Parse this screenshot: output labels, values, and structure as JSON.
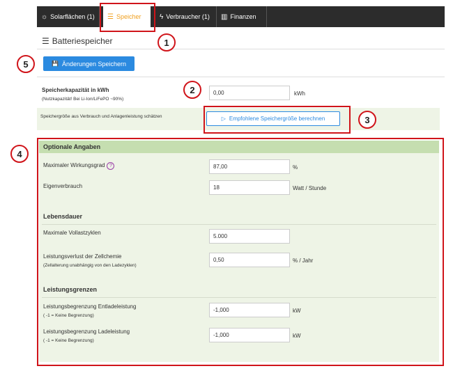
{
  "tabs": [
    {
      "label": "Solarflächen (1)",
      "icon": "sun-icon",
      "glyph": "☼"
    },
    {
      "label": "Speicher",
      "icon": "battery-list-icon",
      "glyph": "☰"
    },
    {
      "label": "Verbraucher (1)",
      "icon": "bolt-icon",
      "glyph": "ϟ"
    },
    {
      "label": "Finanzen",
      "icon": "chart-icon",
      "glyph": "▥"
    }
  ],
  "section": {
    "title": "Batteriespeicher",
    "icon_glyph": "☰"
  },
  "toolbar": {
    "save_label": "Änderungen Speichern",
    "save_icon": "💾"
  },
  "capacity": {
    "label": "Speicherkapazität in kWh",
    "sublabel": "(Nutzkapazität! Bei Li-Ion/LiFePO ~90%)",
    "value": "0,00",
    "unit": "kWh"
  },
  "estimate": {
    "label": "Speichergröße aus Verbrauch und Anlagenleistung schätzen",
    "button_label": "Empfohlene Speichergröße berechnen",
    "button_icon": "▷"
  },
  "optional": {
    "title": "Optionale Angaben",
    "efficiency": {
      "label": "Maximaler Wirkungsgrad",
      "help": "?",
      "value": "87,00",
      "unit": "%"
    },
    "self_consumption": {
      "label": "Eigenverbrauch",
      "value": "18",
      "unit": "Watt / Stunde"
    },
    "lifetime_title": "Lebensdauer",
    "cycles": {
      "label": "Maximale Vollastzyklen",
      "value": "5.000"
    },
    "cell_loss": {
      "label": "Leistungsverlust der Zellchemie",
      "sublabel": "(Zellalterung unabhängig von den Ladezyklen)",
      "value": "0,50",
      "unit": "% / Jahr"
    },
    "limits_title": "Leistungsgrenzen",
    "discharge_limit": {
      "label": "Leistungsbegrenzung Entladeleistung",
      "sublabel": "( -1 = Keine Begrenzung)",
      "value": "-1,000",
      "unit": "kW"
    },
    "charge_limit": {
      "label": "Leistungsbegrenzung Ladeleistung",
      "sublabel": "( -1 = Keine Begrenzung)",
      "value": "-1,000",
      "unit": "kW"
    }
  },
  "annotations": {
    "b1": "1",
    "b2": "2",
    "b3": "3",
    "b4": "4",
    "b5": "5"
  },
  "colors": {
    "accent": "#2b8ae0",
    "tab_active": "#f0a020",
    "annotation": "#d0141a",
    "optional_bg": "#eef4e6",
    "optional_header": "#c5deb0"
  }
}
